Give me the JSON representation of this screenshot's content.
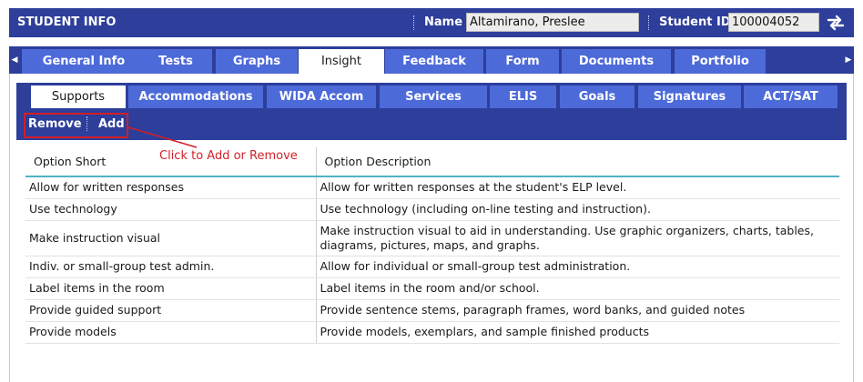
{
  "header": {
    "title": "STUDENT INFO",
    "name_label": "Name",
    "name_value": "Altamirano, Preslee",
    "id_label": "Student ID",
    "id_value": "100004052",
    "swap_icon": "swap-arrows-icon"
  },
  "colors": {
    "bar": "#2d3e9b",
    "tab": "#4d6ad9",
    "accent_line": "#4fb3c8",
    "annotation": "#d21f26"
  },
  "main_tabs": [
    {
      "label": "General Info",
      "active": false
    },
    {
      "label": "Tests",
      "active": false
    },
    {
      "label": "Graphs",
      "active": false
    },
    {
      "label": "Insight",
      "active": true
    },
    {
      "label": "Feedback",
      "active": false
    },
    {
      "label": "Form",
      "active": false
    },
    {
      "label": "Documents",
      "active": false
    },
    {
      "label": "Portfolio",
      "active": false
    }
  ],
  "sub_tabs": [
    {
      "label": "Supports",
      "active": true
    },
    {
      "label": "Accommodations",
      "active": false
    },
    {
      "label": "WIDA Accom",
      "active": false
    },
    {
      "label": "Services",
      "active": false
    },
    {
      "label": "ELIS",
      "active": false
    },
    {
      "label": "Goals",
      "active": false
    },
    {
      "label": "Signatures",
      "active": false
    },
    {
      "label": "ACT/SAT",
      "active": false
    }
  ],
  "toolbar": {
    "remove_label": "Remove",
    "add_label": "Add"
  },
  "annotation": {
    "text": "Click to Add or Remove"
  },
  "table": {
    "columns": [
      "Option Short",
      "Option Description"
    ],
    "rows": [
      [
        "Allow for written responses",
        "Allow for written responses at the student's ELP level."
      ],
      [
        "Use technology",
        "Use technology (including on-line testing and instruction)."
      ],
      [
        "Make instruction visual",
        "Make instruction visual to aid in understanding. Use graphic organizers, charts, tables, diagrams, pictures, maps, and graphs."
      ],
      [
        "Indiv. or small-group test admin.",
        "Allow for individual or small-group test administration."
      ],
      [
        "Label items in the room",
        "Label items in the room and/or school."
      ],
      [
        "Provide guided support",
        "Provide sentence stems, paragraph frames, word banks, and guided notes"
      ],
      [
        "Provide models",
        "Provide models, exemplars, and sample finished products"
      ]
    ]
  }
}
